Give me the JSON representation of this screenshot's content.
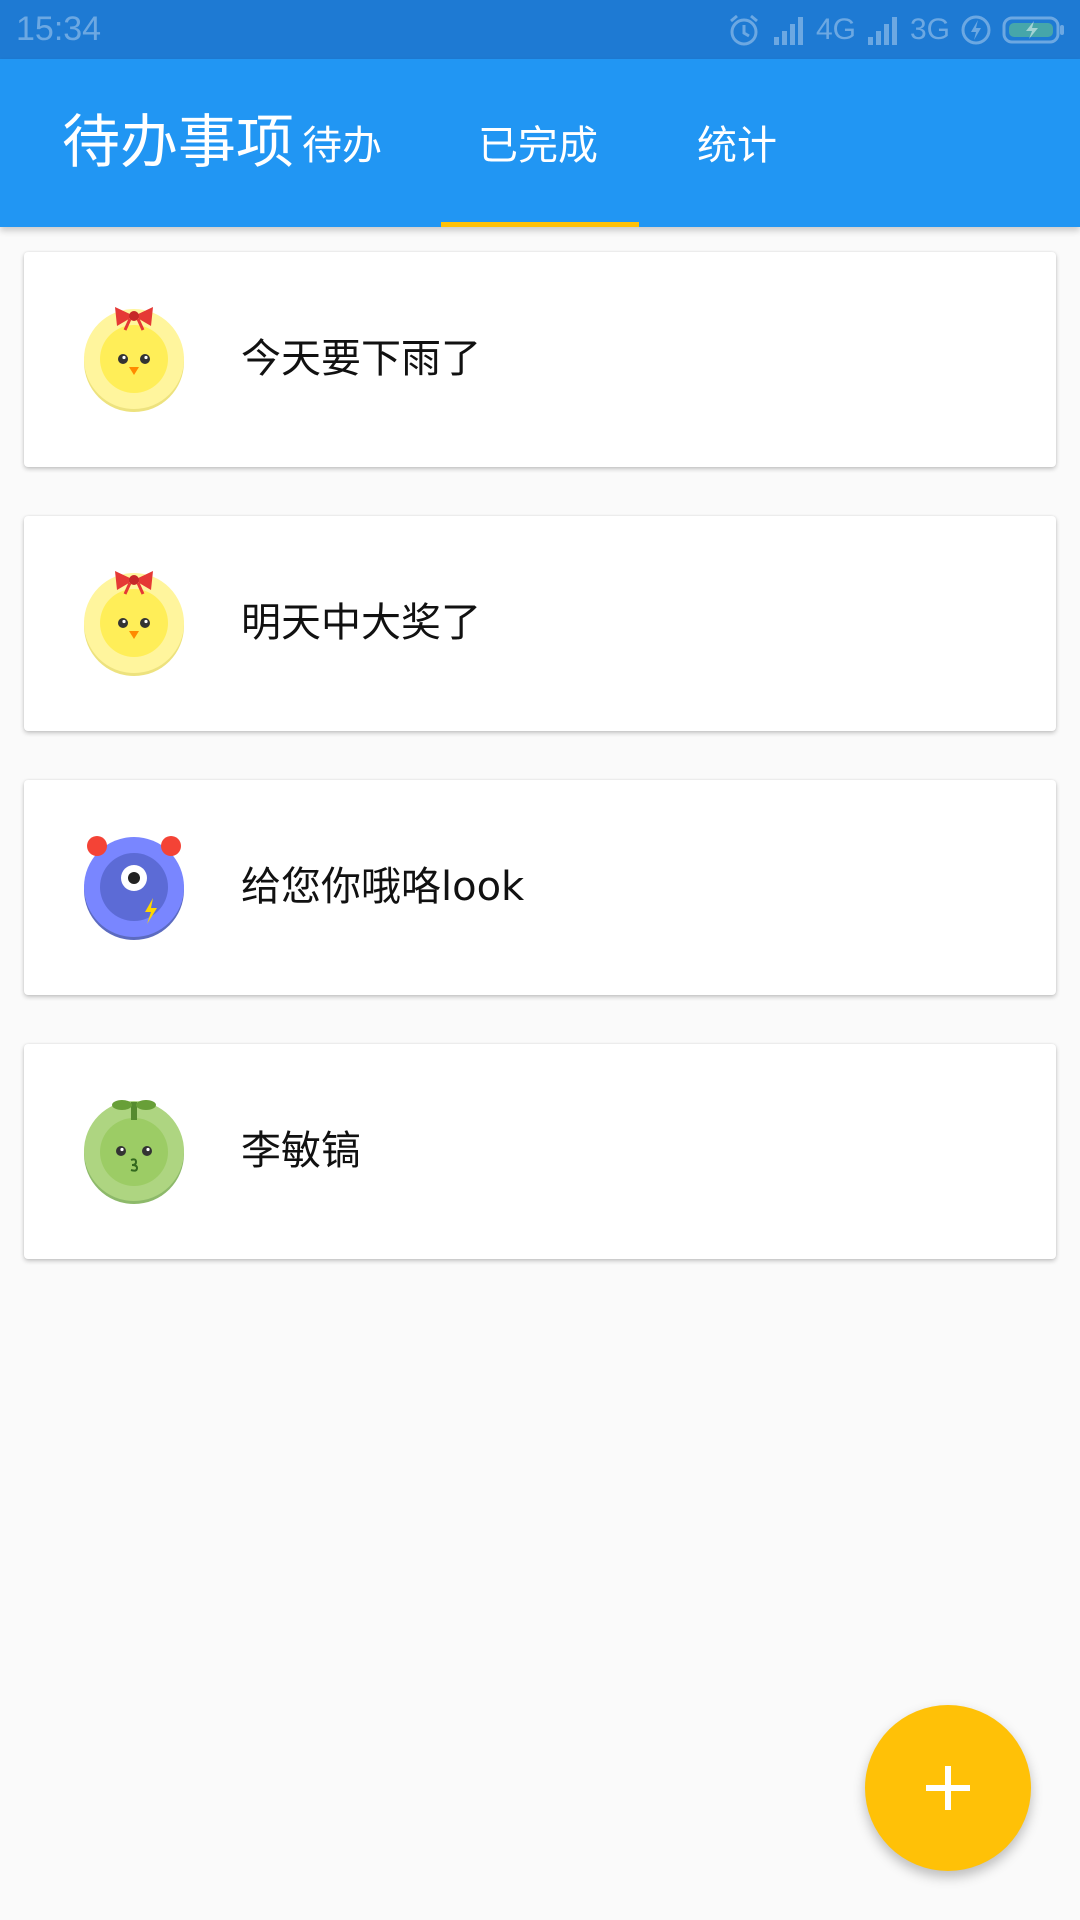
{
  "status_bar": {
    "time": "15:34",
    "network_1": "4G",
    "network_2": "3G",
    "icons": [
      "alarm-icon",
      "signal-icon",
      "signal-icon",
      "charging-icon",
      "battery-icon"
    ]
  },
  "app_bar": {
    "title": "待办事项",
    "tabs": [
      {
        "label": "待办",
        "selected": false
      },
      {
        "label": "已完成",
        "selected": true
      },
      {
        "label": "统计",
        "selected": false
      }
    ],
    "indicator_color": "#FFC107",
    "background_color": "#2196F3"
  },
  "todo_list": {
    "items": [
      {
        "title": "今天要下雨了",
        "avatar": "chick-icon"
      },
      {
        "title": "明天中大奖了",
        "avatar": "chick-icon"
      },
      {
        "title": "给您你哦咯look",
        "avatar": "alarm-monster-icon"
      },
      {
        "title": "李敏镐",
        "avatar": "sprout-icon"
      }
    ]
  },
  "fab": {
    "icon": "plus-icon",
    "color": "#FFC107"
  }
}
